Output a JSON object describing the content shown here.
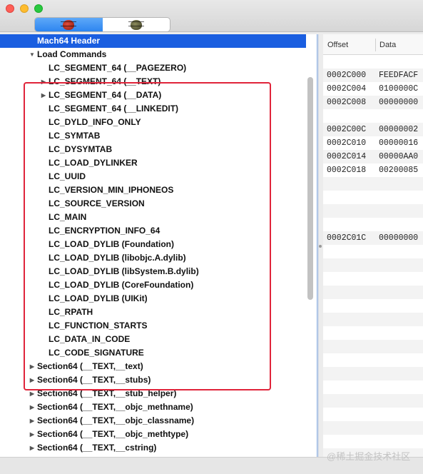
{
  "toolbar": {
    "modes": [
      {
        "icon": "red-beetle-icon",
        "active": true
      },
      {
        "icon": "olive-beetle-icon",
        "active": false
      }
    ]
  },
  "tree": {
    "items": [
      {
        "label": "Mach64 Header",
        "selected": true,
        "expander": ""
      },
      {
        "label": "Load Commands",
        "expander": "▼"
      },
      {
        "label": "LC_SEGMENT_64 (__PAGEZERO)",
        "expander": ""
      },
      {
        "label": "LC_SEGMENT_64 (__TEXT)",
        "expander": "▶"
      },
      {
        "label": "LC_SEGMENT_64 (__DATA)",
        "expander": "▶"
      },
      {
        "label": "LC_SEGMENT_64 (__LINKEDIT)",
        "expander": ""
      },
      {
        "label": "LC_DYLD_INFO_ONLY",
        "expander": ""
      },
      {
        "label": "LC_SYMTAB",
        "expander": ""
      },
      {
        "label": "LC_DYSYMTAB",
        "expander": ""
      },
      {
        "label": "LC_LOAD_DYLINKER",
        "expander": ""
      },
      {
        "label": "LC_UUID",
        "expander": ""
      },
      {
        "label": "LC_VERSION_MIN_IPHONEOS",
        "expander": ""
      },
      {
        "label": "LC_SOURCE_VERSION",
        "expander": ""
      },
      {
        "label": "LC_MAIN",
        "expander": ""
      },
      {
        "label": "LC_ENCRYPTION_INFO_64",
        "expander": ""
      },
      {
        "label": "LC_LOAD_DYLIB (Foundation)",
        "expander": ""
      },
      {
        "label": "LC_LOAD_DYLIB (libobjc.A.dylib)",
        "expander": ""
      },
      {
        "label": "LC_LOAD_DYLIB (libSystem.B.dylib)",
        "expander": ""
      },
      {
        "label": "LC_LOAD_DYLIB (CoreFoundation)",
        "expander": ""
      },
      {
        "label": "LC_LOAD_DYLIB (UIKit)",
        "expander": ""
      },
      {
        "label": "LC_RPATH",
        "expander": ""
      },
      {
        "label": "LC_FUNCTION_STARTS",
        "expander": ""
      },
      {
        "label": "LC_DATA_IN_CODE",
        "expander": ""
      },
      {
        "label": "LC_CODE_SIGNATURE",
        "expander": ""
      },
      {
        "label": "Section64 (__TEXT,__text)",
        "expander": "▶"
      },
      {
        "label": "Section64 (__TEXT,__stubs)",
        "expander": "▶"
      },
      {
        "label": "Section64 (__TEXT,__stub_helper)",
        "expander": "▶"
      },
      {
        "label": "Section64 (__TEXT,__objc_methname)",
        "expander": "▶"
      },
      {
        "label": "Section64 (__TEXT,__objc_classname)",
        "expander": "▶"
      },
      {
        "label": "Section64 (__TEXT,__objc_methtype)",
        "expander": "▶"
      },
      {
        "label": "Section64 (__TEXT,__cstring)",
        "expander": "▶"
      }
    ]
  },
  "table": {
    "headers": {
      "offset": "Offset",
      "data": "Data"
    },
    "rows": [
      {
        "offset": "",
        "data": ""
      },
      {
        "offset": "0002C000",
        "data": "FEEDFACF"
      },
      {
        "offset": "0002C004",
        "data": "0100000C"
      },
      {
        "offset": "0002C008",
        "data": "00000000"
      },
      {
        "offset": "",
        "data": ""
      },
      {
        "offset": "0002C00C",
        "data": "00000002"
      },
      {
        "offset": "0002C010",
        "data": "00000016"
      },
      {
        "offset": "0002C014",
        "data": "00000AA0"
      },
      {
        "offset": "0002C018",
        "data": "00200085"
      },
      {
        "offset": "",
        "data": ""
      },
      {
        "offset": "",
        "data": ""
      },
      {
        "offset": "",
        "data": ""
      },
      {
        "offset": "",
        "data": ""
      },
      {
        "offset": "0002C01C",
        "data": "00000000"
      },
      {
        "offset": "",
        "data": ""
      },
      {
        "offset": "",
        "data": ""
      },
      {
        "offset": "",
        "data": ""
      },
      {
        "offset": "",
        "data": ""
      },
      {
        "offset": "",
        "data": ""
      },
      {
        "offset": "",
        "data": ""
      },
      {
        "offset": "",
        "data": ""
      },
      {
        "offset": "",
        "data": ""
      },
      {
        "offset": "",
        "data": ""
      },
      {
        "offset": "",
        "data": ""
      },
      {
        "offset": "",
        "data": ""
      },
      {
        "offset": "",
        "data": ""
      },
      {
        "offset": "",
        "data": ""
      },
      {
        "offset": "",
        "data": ""
      },
      {
        "offset": "",
        "data": ""
      },
      {
        "offset": "",
        "data": ""
      }
    ]
  },
  "watermark": "@稀土掘金技术社区",
  "colors": {
    "selection": "#1a5ee0",
    "highlight_box": "#e0243a",
    "segment_active": "#2d85f0"
  }
}
